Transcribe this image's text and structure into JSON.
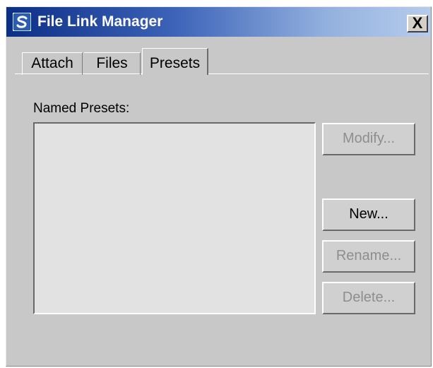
{
  "window": {
    "title": "File Link Manager",
    "app_icon": "3ds-max-app-icon",
    "close_label": "X"
  },
  "tabs": [
    {
      "label": "Attach",
      "active": false
    },
    {
      "label": "Files",
      "active": false
    },
    {
      "label": "Presets",
      "active": true
    }
  ],
  "presets": {
    "list_label": "Named Presets:",
    "items": []
  },
  "buttons": {
    "modify": {
      "label": "Modify...",
      "enabled": false
    },
    "new": {
      "label": "New...",
      "enabled": true
    },
    "rename": {
      "label": "Rename...",
      "enabled": false
    },
    "delete": {
      "label": "Delete...",
      "enabled": false
    }
  },
  "colors": {
    "title_gradient_start": "#0c2f86",
    "title_gradient_end": "#b7ccec",
    "dialog_bg": "#c8c8c8",
    "disabled_text": "#8e8e8e"
  }
}
